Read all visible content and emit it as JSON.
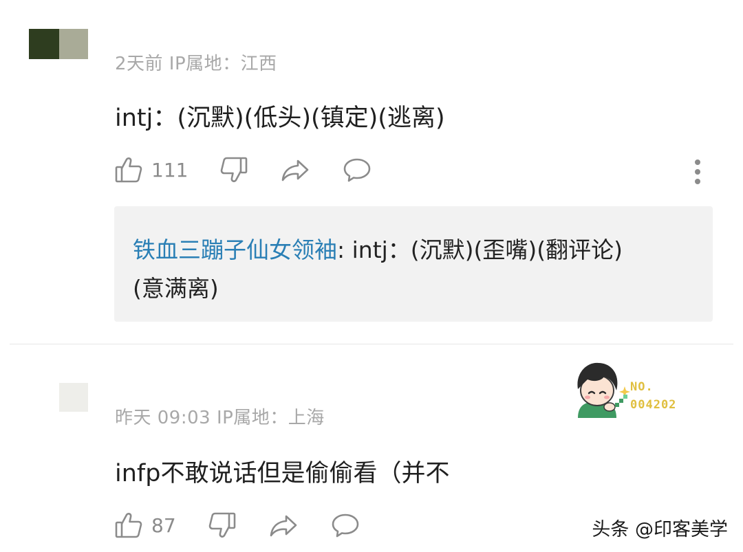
{
  "comments": [
    {
      "meta": "2天前 IP属地：江西",
      "content": "intj：(沉默)(低头)(镇定)(逃离)",
      "likes": "111"
    },
    {
      "meta": "昨天 09:03 IP属地：上海",
      "content": "infp不敢说话但是偷偷看（并不",
      "likes": "87"
    }
  ],
  "reply": {
    "author": "铁血三蹦子仙女领袖",
    "text_line1": ": intj：(沉默)(歪嘴)(翻评论)",
    "text_line2": "(意满离)"
  },
  "badge": {
    "line1": "NO.",
    "line2": "004202"
  },
  "watermark": "头条 @印客美学",
  "colors": {
    "reply_author": "#2a7fb5",
    "meta_text": "#a8a8a8",
    "icon": "#8b8b8b",
    "reply_bg": "#f2f2f2",
    "badge_text": "#e0bf3f"
  },
  "icons": [
    "thumbs-up-icon",
    "thumbs-down-icon",
    "share-icon",
    "comment-icon",
    "more-icon"
  ]
}
